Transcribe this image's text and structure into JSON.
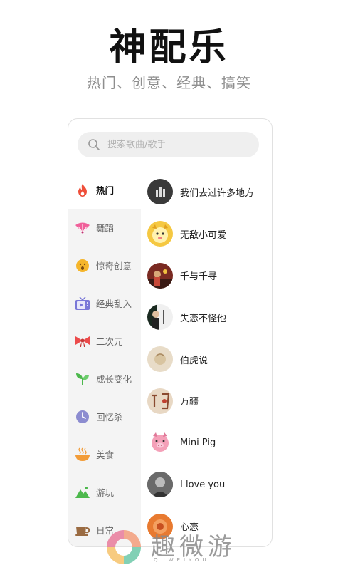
{
  "header": {
    "title": "神配乐",
    "subtitle": "热门、创意、经典、搞笑"
  },
  "search": {
    "placeholder": "搜索歌曲/歌手"
  },
  "categories": [
    {
      "label": "热门",
      "icon": "flame-icon",
      "color": "#ef4f3a",
      "active": true
    },
    {
      "label": "舞蹈",
      "icon": "fan-icon",
      "color": "#f0609a",
      "active": false
    },
    {
      "label": "惊奇创意",
      "icon": "surprised-face-icon",
      "color": "#f5b52a",
      "active": false
    },
    {
      "label": "经典乱入",
      "icon": "tv-icon",
      "color": "#7a78d8",
      "active": false
    },
    {
      "label": "二次元",
      "icon": "bow-icon",
      "color": "#ec4b4b",
      "active": false
    },
    {
      "label": "成长变化",
      "icon": "sprout-icon",
      "color": "#4cb84c",
      "active": false
    },
    {
      "label": "回忆杀",
      "icon": "clock-icon",
      "color": "#8c8cd0",
      "active": false
    },
    {
      "label": "美食",
      "icon": "bowl-icon",
      "color": "#f29c38",
      "active": false
    },
    {
      "label": "游玩",
      "icon": "mountain-icon",
      "color": "#4cb84c",
      "active": false
    },
    {
      "label": "日常",
      "icon": "cup-icon",
      "color": "#9a6b42",
      "active": false
    }
  ],
  "songs": [
    {
      "name": "我们去过许多地方",
      "avatar_color": "#3a3a3a"
    },
    {
      "name": "无敌小可爱",
      "avatar_color": "#f5c842"
    },
    {
      "name": "千与千寻",
      "avatar_color": "#7a2a22"
    },
    {
      "name": "失恋不怪他",
      "avatar_color": "#2a3a30"
    },
    {
      "name": "伯虎说",
      "avatar_color": "#e8dcc8"
    },
    {
      "name": "万疆",
      "avatar_color": "#c89878"
    },
    {
      "name": "Mini Pig",
      "avatar_color": "#f4a0b8"
    },
    {
      "name": "I love you",
      "avatar_color": "#555555"
    },
    {
      "name": "心恋",
      "avatar_color": "#e87a30"
    }
  ],
  "watermark": {
    "text": "趣微游",
    "sub": "QUWEIYOU"
  }
}
